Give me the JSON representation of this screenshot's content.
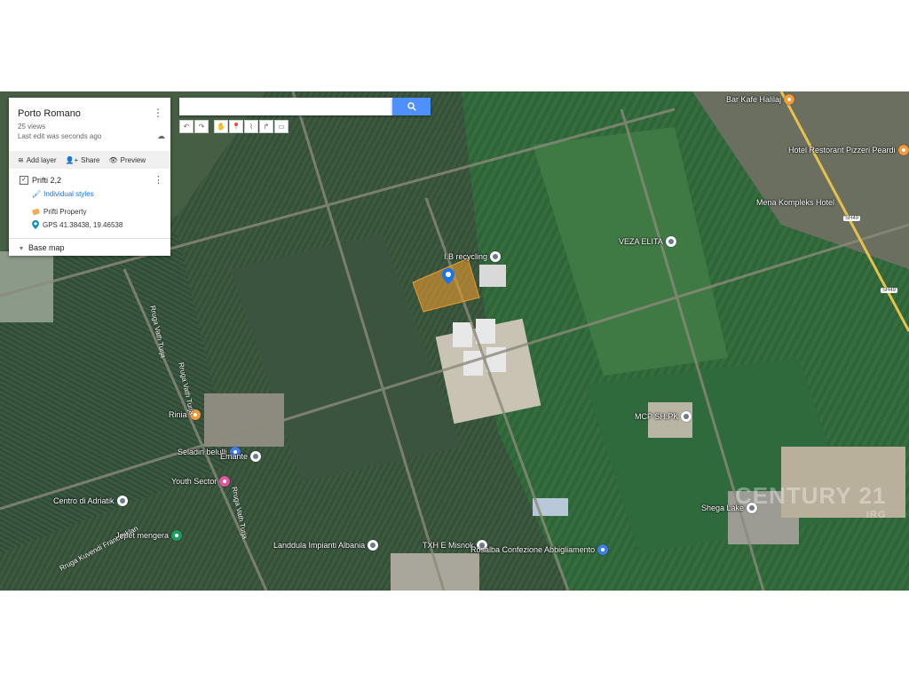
{
  "panel": {
    "title": "Porto Romano",
    "views": "25 views",
    "last_edit": "Last edit was seconds ago",
    "actions": {
      "add_layer": "Add layer",
      "share": "Share",
      "preview": "Preview"
    },
    "layer": {
      "name": "Prifti 2,2",
      "styles": "Individual styles",
      "features": [
        {
          "label": "Prifti Property",
          "icon": "polygon-icon"
        },
        {
          "label": "GPS 41.38438, 19.46538",
          "icon": "location-pin-icon"
        }
      ]
    },
    "base_map": "Base map"
  },
  "search": {
    "placeholder": "",
    "value": ""
  },
  "toolbar": [
    "undo-icon",
    "redo-icon",
    "hand-icon",
    "add-marker-icon",
    "draw-line-icon",
    "route-icon",
    "ruler-icon"
  ],
  "map": {
    "pois": [
      {
        "name": "I.B recycling",
        "type": "grey"
      },
      {
        "name": "VEZA ELITA",
        "type": "grey"
      },
      {
        "name": "Bar Kafe Halilaj",
        "type": "orange"
      },
      {
        "name": "Hotel Restorant Pizzeri Peardi",
        "type": "orange"
      },
      {
        "name": "Mena Kompleks Hotel",
        "type": "none"
      },
      {
        "name": "MCP SH.PK",
        "type": "grey"
      },
      {
        "name": "Rinia",
        "type": "orange"
      },
      {
        "name": "Seladin belulli",
        "type": "blue"
      },
      {
        "name": "Emante",
        "type": "grey"
      },
      {
        "name": "Youth Sector",
        "type": "pink"
      },
      {
        "name": "Centro di Adriatik",
        "type": "grey"
      },
      {
        "name": "Jepet mengera",
        "type": "green"
      },
      {
        "name": "Landdula Impianti Albania",
        "type": "grey"
      },
      {
        "name": "TXH E Misnok",
        "type": "grey"
      },
      {
        "name": "Rosalba Confezione Abbigliamento",
        "type": "blue"
      },
      {
        "name": "Shega Lake",
        "type": "grey"
      }
    ],
    "roads": [
      "Rruga Vath Turja",
      "Rruga Vath Turja",
      "Rruga Vath Turja",
      "Rruga Kuvendi Francesklan"
    ],
    "shields": [
      "SH49",
      "SH49"
    ],
    "watermark": "CENTURY 21",
    "watermark_sub": "IRG"
  },
  "colors": {
    "accent": "#4d90fe",
    "parcel": "#e89a2e",
    "link": "#1a73e8"
  }
}
